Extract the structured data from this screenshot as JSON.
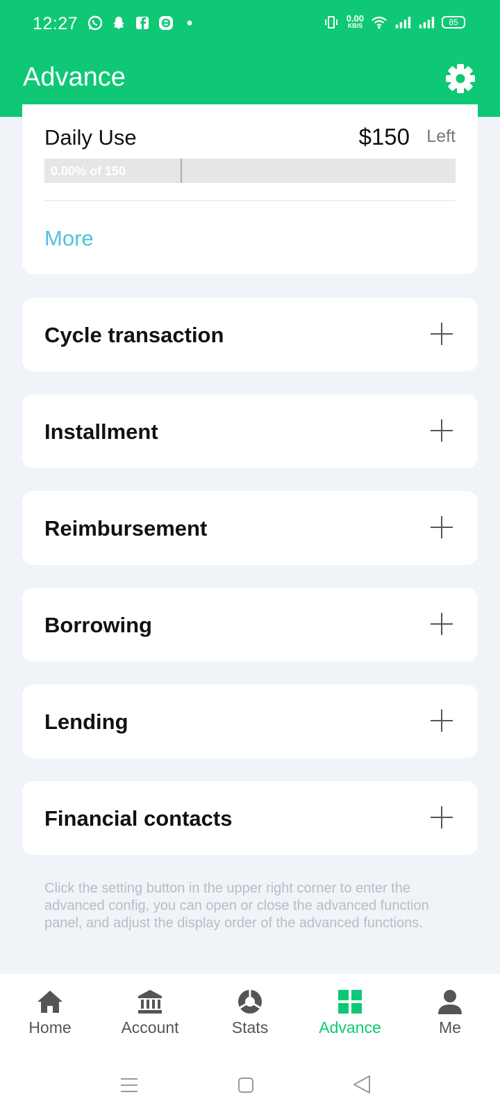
{
  "status_bar": {
    "time": "12:27",
    "net_speed": "0.00",
    "net_unit": "KB/S",
    "battery": "85"
  },
  "header": {
    "title": "Advance"
  },
  "budget": {
    "name": "Daily Use",
    "amount": "$150",
    "left_label": "Left",
    "progress_text": "0.00%  of  150",
    "progress": 0,
    "more_label": "More"
  },
  "items": [
    {
      "label": "Cycle transaction"
    },
    {
      "label": "Installment"
    },
    {
      "label": "Reimbursement"
    },
    {
      "label": "Borrowing"
    },
    {
      "label": "Lending"
    },
    {
      "label": "Financial contacts"
    }
  ],
  "hint": "Click the setting button in the upper right corner to enter the advanced config, you can open or close the advanced function panel, and adjust the display order of the advanced functions.",
  "tabs": [
    {
      "label": "Home",
      "icon": "home-icon"
    },
    {
      "label": "Account",
      "icon": "bank-icon"
    },
    {
      "label": "Stats",
      "icon": "chart-icon"
    },
    {
      "label": "Advance",
      "icon": "grid-icon",
      "active": true
    },
    {
      "label": "Me",
      "icon": "person-icon"
    }
  ],
  "colors": {
    "brand": "#0fc875",
    "link": "#4fc3dc"
  }
}
